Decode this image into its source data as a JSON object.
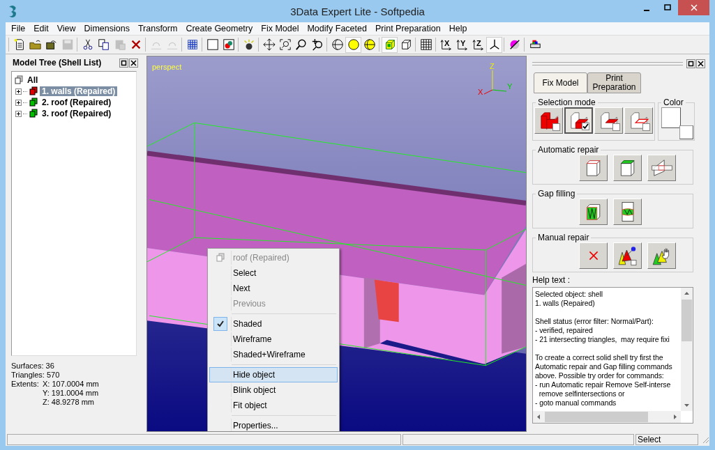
{
  "window": {
    "title": "3Data Expert Lite - Softpedia"
  },
  "menu": [
    "File",
    "Edit",
    "View",
    "Dimensions",
    "Transform",
    "Create Geometry",
    "Fix Model",
    "Modify Faceted",
    "Print Preparation",
    "Help"
  ],
  "toolbar": [
    [
      {
        "kind": "new",
        "disabled": false,
        "pressed": false
      },
      {
        "kind": "open",
        "disabled": false,
        "pressed": false
      },
      {
        "kind": "export",
        "disabled": false,
        "pressed": false
      },
      {
        "kind": "save",
        "disabled": true,
        "pressed": false
      }
    ],
    [
      {
        "kind": "cut",
        "disabled": false,
        "pressed": false
      },
      {
        "kind": "copy",
        "disabled": false,
        "pressed": false
      },
      {
        "kind": "paste",
        "disabled": true,
        "pressed": false
      },
      {
        "kind": "delete",
        "disabled": false,
        "pressed": false
      }
    ],
    [
      {
        "kind": "undo",
        "disabled": true,
        "pressed": false
      },
      {
        "kind": "redo",
        "disabled": true,
        "pressed": false
      }
    ],
    [
      {
        "kind": "checker",
        "disabled": false,
        "pressed": false
      }
    ],
    [
      {
        "kind": "square",
        "disabled": false,
        "pressed": false
      },
      {
        "kind": "colors",
        "disabled": false,
        "pressed": false
      }
    ],
    [
      {
        "kind": "light",
        "disabled": false,
        "pressed": false
      }
    ],
    [
      {
        "kind": "move",
        "disabled": false,
        "pressed": false
      },
      {
        "kind": "zoomwin",
        "disabled": false,
        "pressed": false
      },
      {
        "kind": "zoom",
        "disabled": false,
        "pressed": false
      },
      {
        "kind": "zoomin",
        "disabled": false,
        "pressed": false
      }
    ],
    [
      {
        "kind": "globe",
        "disabled": false,
        "pressed": false
      },
      {
        "kind": "sphere",
        "disabled": false,
        "pressed": true
      },
      {
        "kind": "spherewire",
        "disabled": false,
        "pressed": false
      }
    ],
    [
      {
        "kind": "cubeshaded",
        "disabled": false,
        "pressed": true
      },
      {
        "kind": "cubewire",
        "disabled": false,
        "pressed": false
      }
    ],
    [
      {
        "kind": "grid",
        "disabled": false,
        "pressed": false
      }
    ],
    [
      {
        "kind": "axis",
        "label": "X",
        "disabled": false,
        "pressed": false
      },
      {
        "kind": "axis",
        "label": "Y",
        "disabled": false,
        "pressed": false
      },
      {
        "kind": "axis",
        "label": "Z",
        "disabled": false,
        "pressed": false
      },
      {
        "kind": "iso",
        "disabled": false,
        "pressed": true
      }
    ],
    [
      {
        "kind": "clip",
        "disabled": false,
        "pressed": false
      }
    ],
    [
      {
        "kind": "print",
        "disabled": false,
        "pressed": false
      }
    ]
  ],
  "model_tree": {
    "title": "Model Tree (Shell List)",
    "root": "All",
    "items": [
      {
        "label": "1. walls (Repaired)",
        "color": "#e00000",
        "selected": true,
        "expanded": false
      },
      {
        "label": "2. roof (Repaired)",
        "color": "#00c000",
        "selected": false,
        "expanded": false
      },
      {
        "label": "3. roof (Repaired)",
        "color": "#00c000",
        "selected": false,
        "expanded": false
      }
    ]
  },
  "stats": {
    "surfaces": "Surfaces: 36",
    "triangles": "Triangles: 570",
    "extents_label": "Extents:",
    "extents": [
      "X: 107.0004 mm",
      "Y: 191.0004 mm",
      "Z: 48.9278 mm"
    ]
  },
  "viewport": {
    "mode": "perspect",
    "axes": {
      "z": "Z",
      "y": "Y",
      "x": "X"
    }
  },
  "context_menu": [
    {
      "kind": "header",
      "label": "roof (Repaired)",
      "disabled": true,
      "checked": false,
      "selected": false
    },
    {
      "kind": "item",
      "label": "Select",
      "disabled": false,
      "checked": false,
      "selected": false
    },
    {
      "kind": "item",
      "label": "Next",
      "disabled": false,
      "checked": false,
      "selected": false
    },
    {
      "kind": "item",
      "label": "Previous",
      "disabled": true,
      "checked": false,
      "selected": false
    },
    {
      "kind": "separator"
    },
    {
      "kind": "item",
      "label": "Shaded",
      "disabled": false,
      "checked": true,
      "selected": false
    },
    {
      "kind": "item",
      "label": "Wireframe",
      "disabled": false,
      "checked": false,
      "selected": false
    },
    {
      "kind": "item",
      "label": "Shaded+Wireframe",
      "disabled": false,
      "checked": false,
      "selected": false
    },
    {
      "kind": "separator"
    },
    {
      "kind": "item",
      "label": "Hide object",
      "disabled": false,
      "checked": false,
      "selected": true
    },
    {
      "kind": "item",
      "label": "Blink object",
      "disabled": false,
      "checked": false,
      "selected": false
    },
    {
      "kind": "item",
      "label": "Fit object",
      "disabled": false,
      "checked": false,
      "selected": false
    },
    {
      "kind": "separator"
    },
    {
      "kind": "item",
      "label": "Properties...",
      "disabled": false,
      "checked": false,
      "selected": false
    }
  ],
  "right_panel": {
    "tabs": [
      {
        "label": "Fix Model",
        "selected": true
      },
      {
        "label": "Print Preparation",
        "selected": false
      }
    ],
    "selection_mode": {
      "title": "Selection mode",
      "buttons": [
        {
          "kind": "solid",
          "selected": false
        },
        {
          "kind": "face",
          "selected": true
        },
        {
          "kind": "edge",
          "selected": false
        },
        {
          "kind": "outline",
          "selected": false
        }
      ]
    },
    "color": {
      "title": "Color"
    },
    "groups": [
      {
        "title": "Automatic repair",
        "buttons": [
          {
            "kind": "cube-edges"
          },
          {
            "kind": "cube-top"
          },
          {
            "kind": "intersect"
          }
        ]
      },
      {
        "title": "Gap filling",
        "buttons": [
          {
            "kind": "gap-cube"
          },
          {
            "kind": "gap-band"
          }
        ]
      },
      {
        "title": "Manual repair",
        "buttons": [
          {
            "kind": "delete"
          },
          {
            "kind": "pin"
          },
          {
            "kind": "hand"
          }
        ]
      }
    ],
    "help": {
      "label": "Help text :",
      "paragraphs": [
        [
          "Selected object: shell",
          "1. walls (Repaired)"
        ],
        [
          "Shell status (error filter: Normal/Part):",
          "- verified, repaired",
          "- 21 intersecting triangles,  may require fixi"
        ],
        [
          "To create a correct solid shell try first the",
          "Automatic repair and Gap filling commands",
          "above. Possible try order for commands:",
          "- run Automatic repair Remove Self-interse",
          "  remove selfintersections or",
          "- goto manual commands"
        ]
      ]
    }
  },
  "status_bar": {
    "mode": "Select"
  }
}
